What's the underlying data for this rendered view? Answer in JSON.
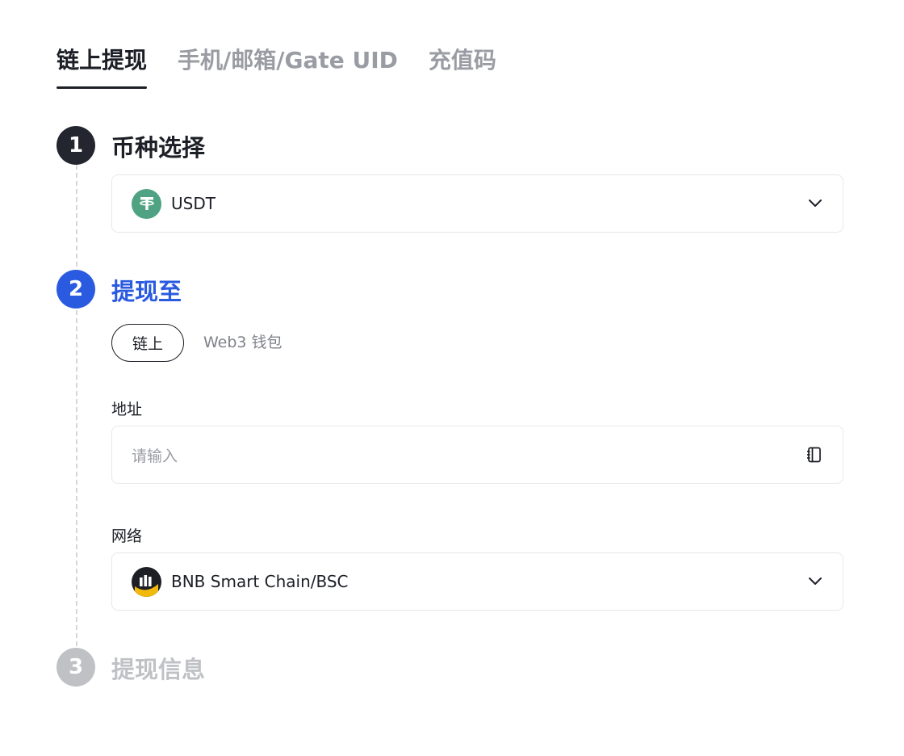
{
  "tabs": [
    {
      "label": "链上提现",
      "active": true
    },
    {
      "label": "手机/邮箱/Gate UID",
      "active": false
    },
    {
      "label": "充值码",
      "active": false
    }
  ],
  "steps": [
    {
      "number": "1",
      "title": "币种选择"
    },
    {
      "number": "2",
      "title": "提现至"
    },
    {
      "number": "3",
      "title": "提现信息"
    }
  ],
  "coin": {
    "symbol": "USDT",
    "icon": "tether-icon",
    "color": "#4fa383"
  },
  "destination": {
    "options": [
      "链上",
      "Web3 钱包"
    ],
    "selected": "链上"
  },
  "address": {
    "label": "地址",
    "placeholder": "请输入",
    "icon": "address-book-icon"
  },
  "network": {
    "label": "网络",
    "value": "BNB Smart Chain/BSC",
    "icon": "bsc-chain-icon"
  },
  "colors": {
    "accent": "#2a5ae0",
    "dark": "#23262e",
    "disabled": "#bfc1c5"
  }
}
